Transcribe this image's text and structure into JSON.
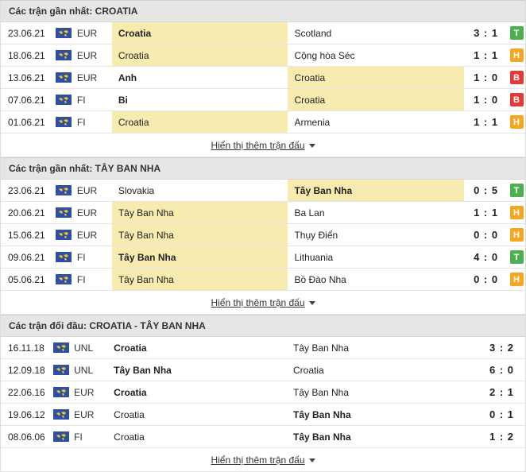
{
  "sections": [
    {
      "title": "Các trận gần nhất: CROATIA",
      "more": "Hiển thị thêm trận đấu",
      "rows": [
        {
          "date": "23.06.21",
          "league": "EUR",
          "home": "Croatia",
          "away": "Scotland",
          "score": "3 : 1",
          "result": "T",
          "home_bold": true,
          "away_bold": false,
          "hl": "home"
        },
        {
          "date": "18.06.21",
          "league": "EUR",
          "home": "Croatia",
          "away": "Cộng hòa Séc",
          "score": "1 : 1",
          "result": "H",
          "home_bold": false,
          "away_bold": false,
          "hl": "home"
        },
        {
          "date": "13.06.21",
          "league": "EUR",
          "home": "Anh",
          "away": "Croatia",
          "score": "1 : 0",
          "result": "B",
          "home_bold": true,
          "away_bold": false,
          "hl": "away"
        },
        {
          "date": "07.06.21",
          "league": "FI",
          "home": "Bi",
          "away": "Croatia",
          "score": "1 : 0",
          "result": "B",
          "home_bold": true,
          "away_bold": false,
          "hl": "away"
        },
        {
          "date": "01.06.21",
          "league": "FI",
          "home": "Croatia",
          "away": "Armenia",
          "score": "1 : 1",
          "result": "H",
          "home_bold": false,
          "away_bold": false,
          "hl": "home"
        }
      ]
    },
    {
      "title": "Các trận gần nhất: TÂY BAN NHA",
      "more": "Hiển thị thêm trận đấu",
      "rows": [
        {
          "date": "23.06.21",
          "league": "EUR",
          "home": "Slovakia",
          "away": "Tây Ban Nha",
          "score": "0 : 5",
          "result": "T",
          "home_bold": false,
          "away_bold": true,
          "hl": "away"
        },
        {
          "date": "20.06.21",
          "league": "EUR",
          "home": "Tây Ban Nha",
          "away": "Ba Lan",
          "score": "1 : 1",
          "result": "H",
          "home_bold": false,
          "away_bold": false,
          "hl": "home"
        },
        {
          "date": "15.06.21",
          "league": "EUR",
          "home": "Tây Ban Nha",
          "away": "Thụy Điển",
          "score": "0 : 0",
          "result": "H",
          "home_bold": false,
          "away_bold": false,
          "hl": "home"
        },
        {
          "date": "09.06.21",
          "league": "FI",
          "home": "Tây Ban Nha",
          "away": "Lithuania",
          "score": "4 : 0",
          "result": "T",
          "home_bold": true,
          "away_bold": false,
          "hl": "home"
        },
        {
          "date": "05.06.21",
          "league": "FI",
          "home": "Tây Ban Nha",
          "away": "Bồ Đào Nha",
          "score": "0 : 0",
          "result": "H",
          "home_bold": false,
          "away_bold": false,
          "hl": "home"
        }
      ]
    },
    {
      "title": "Các trận đối đầu: CROATIA - TÂY BAN NHA",
      "more": "Hiển thị thêm trận đấu",
      "h2h": true,
      "rows": [
        {
          "date": "16.11.18",
          "league": "UNL",
          "home": "Croatia",
          "away": "Tây Ban Nha",
          "score": "3 : 2",
          "home_bold": true,
          "away_bold": false
        },
        {
          "date": "12.09.18",
          "league": "UNL",
          "home": "Tây Ban Nha",
          "away": "Croatia",
          "score": "6 : 0",
          "home_bold": true,
          "away_bold": false
        },
        {
          "date": "22.06.16",
          "league": "EUR",
          "home": "Croatia",
          "away": "Tây Ban Nha",
          "score": "2 : 1",
          "home_bold": true,
          "away_bold": false
        },
        {
          "date": "19.06.12",
          "league": "EUR",
          "home": "Croatia",
          "away": "Tây Ban Nha",
          "score": "0 : 1",
          "home_bold": false,
          "away_bold": true
        },
        {
          "date": "08.06.06",
          "league": "FI",
          "home": "Croatia",
          "away": "Tây Ban Nha",
          "score": "1 : 2",
          "home_bold": false,
          "away_bold": true
        }
      ]
    }
  ],
  "result_colors": {
    "T": "#4caf50",
    "H": "#f5a623",
    "B": "#e53935"
  },
  "colors": {
    "highlight": "#f8ebb0",
    "flag_blue": "#2d4fa5",
    "flag_star": "#f5c518"
  },
  "icons": {
    "league_flag": "world-flag-icon",
    "expand": "caret-down-icon"
  }
}
